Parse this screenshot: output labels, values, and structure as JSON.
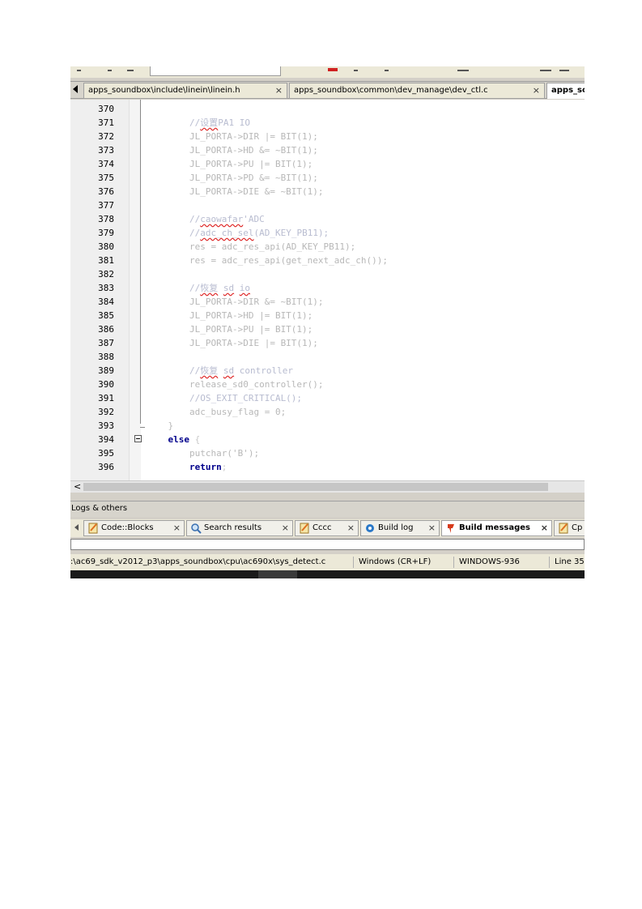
{
  "editor_tabs": [
    {
      "label": "apps_soundbox\\include\\linein\\linein.h",
      "close": "×"
    },
    {
      "label": "apps_soundbox\\common\\dev_manage\\dev_ctl.c",
      "close": "×"
    },
    {
      "label": "apps_sc",
      "close": ""
    }
  ],
  "code_lines": [
    {
      "n": "370",
      "text": ""
    },
    {
      "n": "371",
      "text": "        //设置PA1 IO"
    },
    {
      "n": "372",
      "text": "        JL_PORTA->DIR |= BIT(1);"
    },
    {
      "n": "373",
      "text": "        JL_PORTA->HD &= ~BIT(1);"
    },
    {
      "n": "374",
      "text": "        JL_PORTA->PU |= BIT(1);"
    },
    {
      "n": "375",
      "text": "        JL_PORTA->PD &= ~BIT(1);"
    },
    {
      "n": "376",
      "text": "        JL_PORTA->DIE &= ~BIT(1);"
    },
    {
      "n": "377",
      "text": ""
    },
    {
      "n": "378",
      "text": "        //caowafar'ADC"
    },
    {
      "n": "379",
      "text": "        //adc_ch_sel(AD_KEY_PB11);"
    },
    {
      "n": "380",
      "text": "        res = adc_res_api(AD_KEY_PB11);"
    },
    {
      "n": "381",
      "text": "        res = adc_res_api(get_next_adc_ch());"
    },
    {
      "n": "382",
      "text": ""
    },
    {
      "n": "383",
      "text": "        //恢复 sd io"
    },
    {
      "n": "384",
      "text": "        JL_PORTA->DIR &= ~BIT(1);"
    },
    {
      "n": "385",
      "text": "        JL_PORTA->HD |= BIT(1);"
    },
    {
      "n": "386",
      "text": "        JL_PORTA->PU |= BIT(1);"
    },
    {
      "n": "387",
      "text": "        JL_PORTA->DIE |= BIT(1);"
    },
    {
      "n": "388",
      "text": ""
    },
    {
      "n": "389",
      "text": "        //恢复 sd controller"
    },
    {
      "n": "390",
      "text": "        release_sd0_controller();"
    },
    {
      "n": "391",
      "text": "        //OS_EXIT_CRITICAL();"
    },
    {
      "n": "392",
      "text": "        adc_busy_flag = 0;"
    },
    {
      "n": "393",
      "text": "    }"
    },
    {
      "n": "394",
      "text": "    else {"
    },
    {
      "n": "395",
      "text": "        putchar('B');"
    },
    {
      "n": "396",
      "text": "        return;"
    }
  ],
  "scroll_left_glyph": "<",
  "logs": {
    "title": "Logs & others",
    "tabs": [
      {
        "label": "Code::Blocks",
        "close": "×"
      },
      {
        "label": "Search results",
        "close": "×"
      },
      {
        "label": "Cccc",
        "close": "×"
      },
      {
        "label": "Build log",
        "close": "×"
      },
      {
        "label": "Build messages",
        "close": "×"
      },
      {
        "label": "Cp",
        "close": ""
      }
    ]
  },
  "status": {
    "path": ":\\ac69_sdk_v2012_p3\\apps_soundbox\\cpu\\ac690x\\sys_detect.c",
    "line_ending": "Windows (CR+LF)",
    "encoding": "WINDOWS-936",
    "position": "Line 35"
  },
  "colors": {
    "keyword": "#00008b",
    "faded_code": "#b8b8b8",
    "active_tab": "#ffffff",
    "build_messages_icon": "#d63a1a"
  }
}
